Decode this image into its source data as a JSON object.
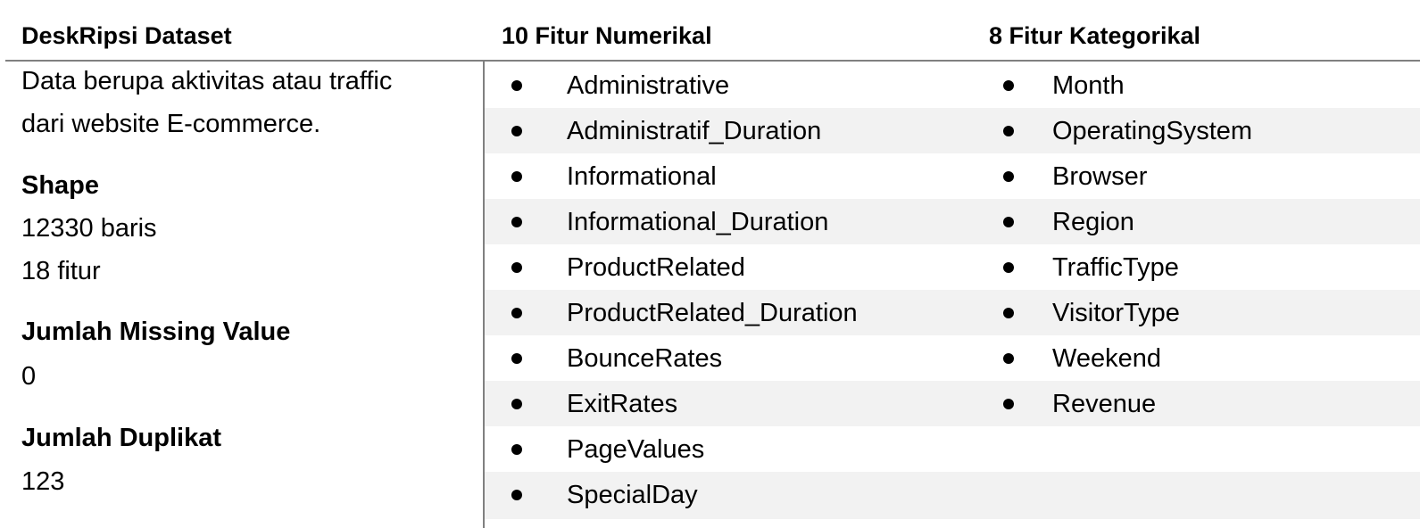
{
  "headers": {
    "description": "DeskRipsi Dataset",
    "numerical": "10 Fitur Numerikal",
    "categorical": "8 Fitur Kategorikal"
  },
  "description": {
    "line1": "Data berupa aktivitas atau traffic",
    "line2": "dari website E-commerce.",
    "shape_label": "Shape",
    "shape_rows": "12330 baris",
    "shape_features": "18 fitur",
    "missing_label": "Jumlah Missing Value",
    "missing_value": "0",
    "duplicate_label": "Jumlah Duplikat",
    "duplicate_value": "123"
  },
  "numerical_features": [
    "Administrative",
    "Administratif_Duration",
    "Informational",
    "Informational_Duration",
    "ProductRelated",
    "ProductRelated_Duration",
    "BounceRates",
    "ExitRates",
    "PageValues",
    "SpecialDay"
  ],
  "categorical_features": [
    "Month",
    "OperatingSystem",
    "Browser",
    "Region",
    "TrafficType",
    "VisitorType",
    "Weekend",
    "Revenue"
  ],
  "colors": {
    "rule": "#808080",
    "row_shade": "#f2f2f2",
    "text": "#000000"
  }
}
